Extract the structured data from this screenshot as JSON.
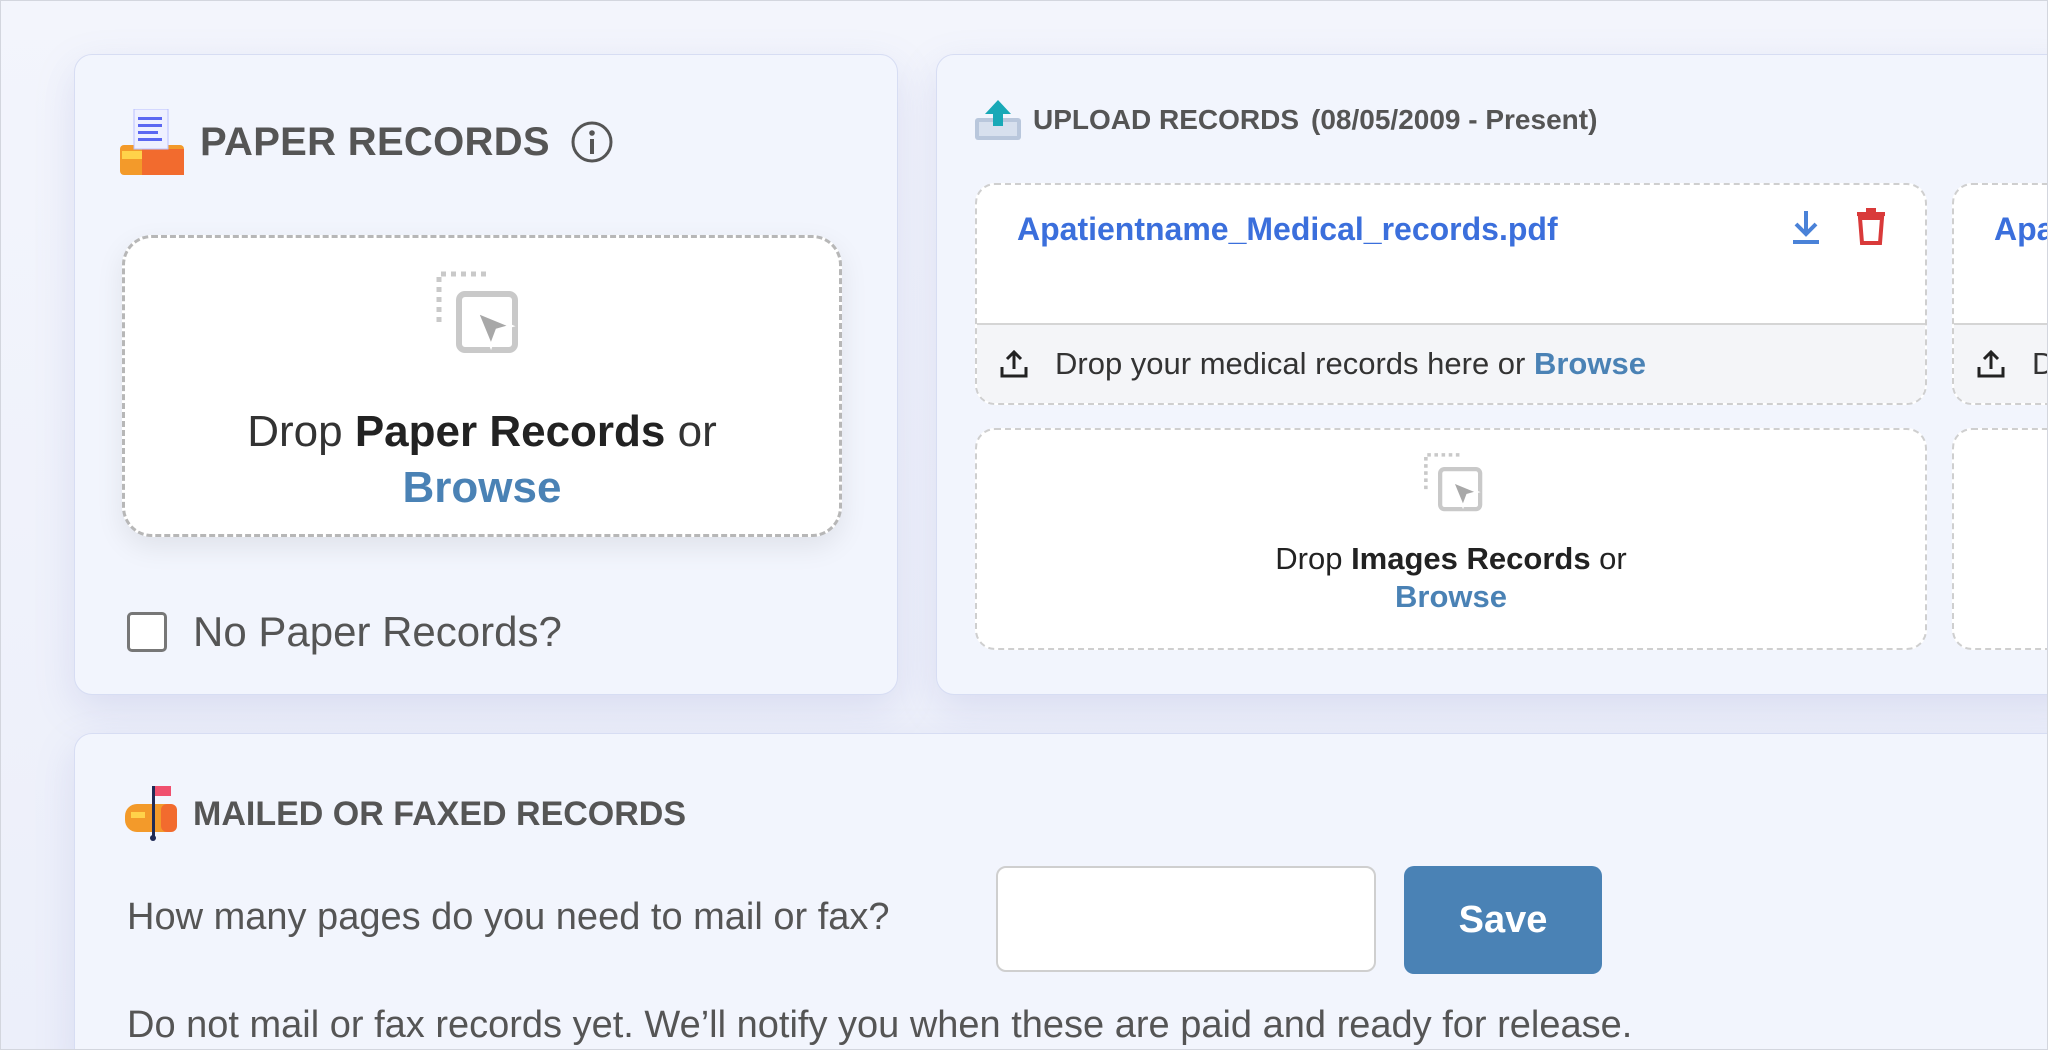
{
  "paper": {
    "title": "PAPER RECORDS",
    "drop_prefix": "Drop ",
    "drop_bold": "Paper Records",
    "drop_suffix": " or",
    "browse": "Browse",
    "no_records_label": "No Paper Records?"
  },
  "upload": {
    "title": "UPLOAD RECORDS",
    "range": "(08/05/2009 - Present)",
    "files": [
      {
        "name": "Apatientname_Medical_records.pdf",
        "footer_text": "Drop your medical records here or ",
        "browse": "Browse"
      },
      {
        "name": "Apa",
        "footer_text": "D",
        "browse": ""
      }
    ],
    "image_drop": {
      "prefix": "Drop ",
      "bold": "Images Records",
      "suffix": " or",
      "browse": "Browse"
    }
  },
  "mail": {
    "title": "MAILED OR FAXED RECORDS",
    "question": "How many pages do you need to mail or fax?",
    "input_value": "",
    "save_label": "Save",
    "note": "Do not mail or fax records yet. We’ll notify you when these are paid and ready for release."
  },
  "colors": {
    "accent": "#4a82b5",
    "link": "#3b6fdc",
    "delete": "#d93a3a"
  }
}
